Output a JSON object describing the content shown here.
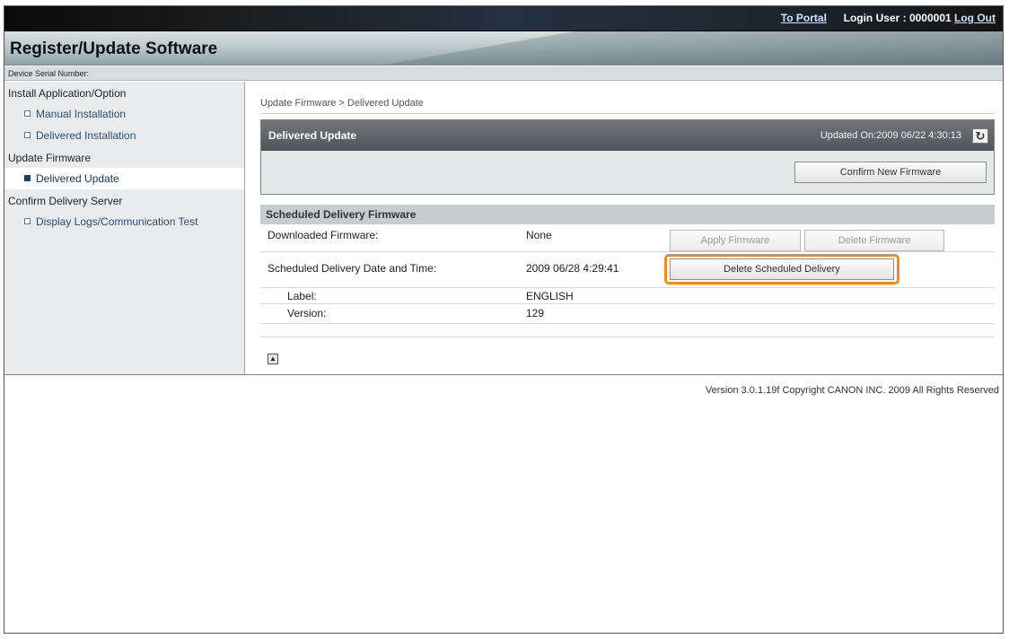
{
  "topbar": {
    "portal_link": "To Portal",
    "login_label": "Login User : 0000001",
    "logout_link": "Log Out"
  },
  "header": {
    "title": "Register/Update Software",
    "serial_label": "Device Serial Number:"
  },
  "sidebar": {
    "sections": [
      {
        "label": "Install Application/Option",
        "items": [
          "Manual Installation",
          "Delivered Installation"
        ]
      },
      {
        "label": "Update Firmware",
        "items": [
          "Delivered Update"
        ]
      },
      {
        "label": "Confirm Delivery Server",
        "items": [
          "Display Logs/Communication Test"
        ]
      }
    ],
    "active_item": "Delivered Update"
  },
  "main": {
    "breadcrumb": "Update Firmware > Delivered Update",
    "panel": {
      "title": "Delivered Update",
      "updated": "Updated On:2009 06/22 4:30:13",
      "confirm_button": "Confirm New Firmware"
    },
    "scheduled": {
      "title": "Scheduled Delivery Firmware",
      "downloaded_label": "Downloaded Firmware:",
      "downloaded_value": "None",
      "apply_button": "Apply Firmware",
      "delete_button": "Delete Firmware",
      "date_label": "Scheduled Delivery Date and Time:",
      "date_value": "2009 06/28 4:29:41",
      "delete_scheduled_button": "Delete Scheduled Delivery",
      "label_label": "Label:",
      "label_value": "ENGLISH",
      "version_label": "Version:",
      "version_value": "129"
    }
  },
  "footer": {
    "copyright": "Version 3.0.1.19f Copyright CANON INC. 2009 All Rights Reserved"
  },
  "colors": {
    "highlight": "#f08c1e",
    "panel_header": "#5a6267"
  }
}
